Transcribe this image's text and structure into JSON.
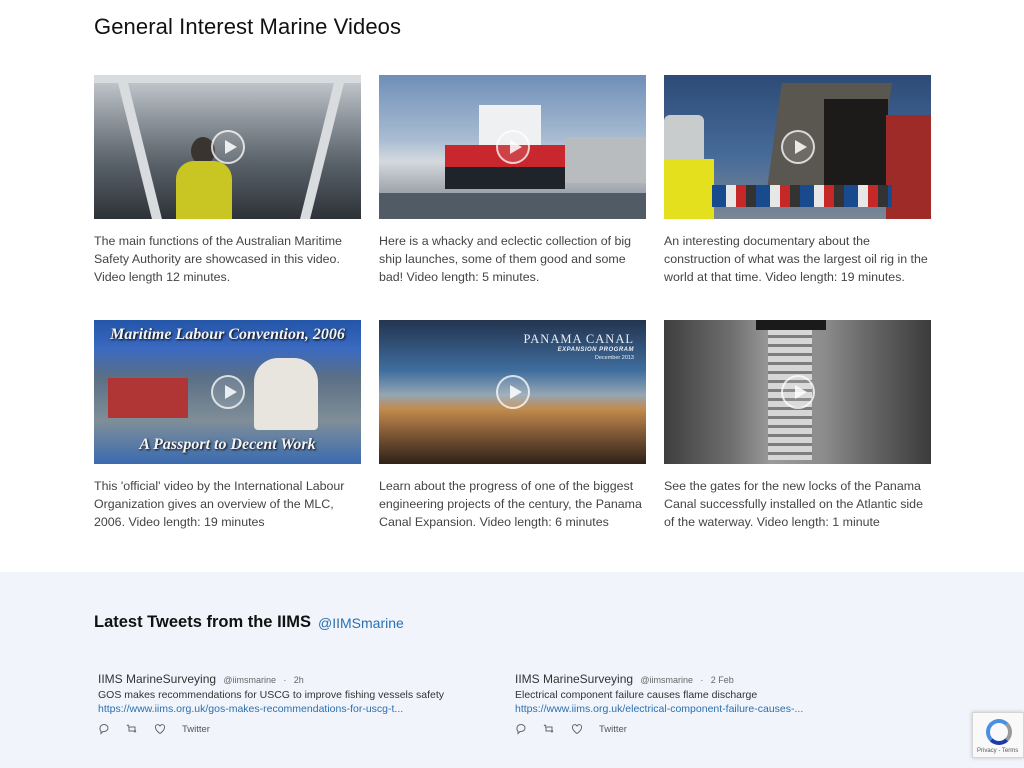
{
  "videos": {
    "title": "General Interest Marine Videos",
    "items": [
      {
        "description": "The main functions of the Australian Maritime Safety Authority are showcased in this video. Video length 12 minutes."
      },
      {
        "description": "Here is a whacky and eclectic collection of big ship launches, some of them good and some bad! Video length: 5 minutes."
      },
      {
        "description": "An interesting documentary about the construction of what was the largest oil rig in the world at that time. Video length: 19 minutes."
      },
      {
        "description": "This 'official' video by the International Labour Organization gives an overview of the MLC, 2006. Video length: 19 minutes",
        "thumb_title": "Maritime Labour Convention, 2006",
        "thumb_subtitle": "A Passport to Decent Work"
      },
      {
        "description": "Learn about the progress of one of the biggest engineering projects of the century, the Panama Canal Expansion. Video length: 6 minutes",
        "thumb_title": "PANAMA CANAL",
        "thumb_subtitle": "EXPANSION PROGRAM",
        "thumb_date": "December 2013"
      },
      {
        "description": "See the gates for the new locks of the Panama Canal successfully installed on the Atlantic side of the waterway. Video length: 1 minute"
      }
    ]
  },
  "tweets": {
    "title": "Latest Tweets from the IIMS",
    "handle": "@IIMSmarine",
    "items": [
      {
        "name": "IIMS MarineSurveying",
        "user": "@iimsmarine",
        "separator": "·",
        "time": "2h",
        "text": "GOS makes recommendations for USCG to improve fishing vessels safety",
        "link": "https://www.iims.org.uk/gos-makes-recommendations-for-uscg-t...",
        "source": "Twitter"
      },
      {
        "name": "IIMS MarineSurveying",
        "user": "@iimsmarine",
        "separator": "·",
        "time": "2 Feb",
        "text": "Electrical component failure causes flame discharge",
        "link": "https://www.iims.org.uk/electrical-component-failure-causes-...",
        "source": "Twitter"
      }
    ]
  },
  "recaptcha": {
    "text": "Privacy - Terms"
  }
}
